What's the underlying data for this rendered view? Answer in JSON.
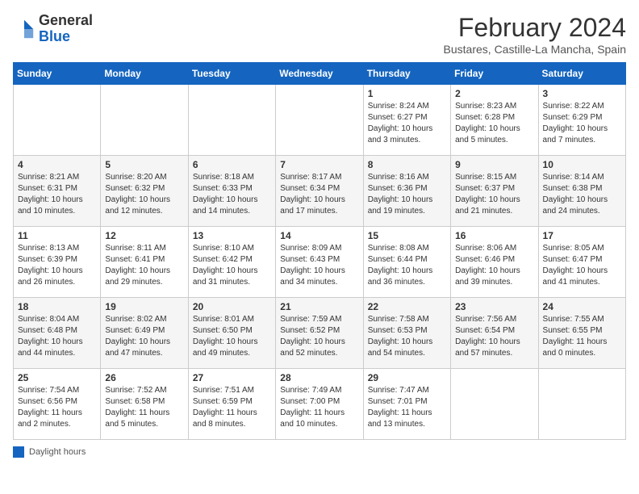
{
  "logo": {
    "general": "General",
    "blue": "Blue"
  },
  "header": {
    "month": "February 2024",
    "location": "Bustares, Castille-La Mancha, Spain"
  },
  "days_of_week": [
    "Sunday",
    "Monday",
    "Tuesday",
    "Wednesday",
    "Thursday",
    "Friday",
    "Saturday"
  ],
  "weeks": [
    [
      {
        "day": "",
        "info": ""
      },
      {
        "day": "",
        "info": ""
      },
      {
        "day": "",
        "info": ""
      },
      {
        "day": "",
        "info": ""
      },
      {
        "day": "1",
        "info": "Sunrise: 8:24 AM\nSunset: 6:27 PM\nDaylight: 10 hours\nand 3 minutes."
      },
      {
        "day": "2",
        "info": "Sunrise: 8:23 AM\nSunset: 6:28 PM\nDaylight: 10 hours\nand 5 minutes."
      },
      {
        "day": "3",
        "info": "Sunrise: 8:22 AM\nSunset: 6:29 PM\nDaylight: 10 hours\nand 7 minutes."
      }
    ],
    [
      {
        "day": "4",
        "info": "Sunrise: 8:21 AM\nSunset: 6:31 PM\nDaylight: 10 hours\nand 10 minutes."
      },
      {
        "day": "5",
        "info": "Sunrise: 8:20 AM\nSunset: 6:32 PM\nDaylight: 10 hours\nand 12 minutes."
      },
      {
        "day": "6",
        "info": "Sunrise: 8:18 AM\nSunset: 6:33 PM\nDaylight: 10 hours\nand 14 minutes."
      },
      {
        "day": "7",
        "info": "Sunrise: 8:17 AM\nSunset: 6:34 PM\nDaylight: 10 hours\nand 17 minutes."
      },
      {
        "day": "8",
        "info": "Sunrise: 8:16 AM\nSunset: 6:36 PM\nDaylight: 10 hours\nand 19 minutes."
      },
      {
        "day": "9",
        "info": "Sunrise: 8:15 AM\nSunset: 6:37 PM\nDaylight: 10 hours\nand 21 minutes."
      },
      {
        "day": "10",
        "info": "Sunrise: 8:14 AM\nSunset: 6:38 PM\nDaylight: 10 hours\nand 24 minutes."
      }
    ],
    [
      {
        "day": "11",
        "info": "Sunrise: 8:13 AM\nSunset: 6:39 PM\nDaylight: 10 hours\nand 26 minutes."
      },
      {
        "day": "12",
        "info": "Sunrise: 8:11 AM\nSunset: 6:41 PM\nDaylight: 10 hours\nand 29 minutes."
      },
      {
        "day": "13",
        "info": "Sunrise: 8:10 AM\nSunset: 6:42 PM\nDaylight: 10 hours\nand 31 minutes."
      },
      {
        "day": "14",
        "info": "Sunrise: 8:09 AM\nSunset: 6:43 PM\nDaylight: 10 hours\nand 34 minutes."
      },
      {
        "day": "15",
        "info": "Sunrise: 8:08 AM\nSunset: 6:44 PM\nDaylight: 10 hours\nand 36 minutes."
      },
      {
        "day": "16",
        "info": "Sunrise: 8:06 AM\nSunset: 6:46 PM\nDaylight: 10 hours\nand 39 minutes."
      },
      {
        "day": "17",
        "info": "Sunrise: 8:05 AM\nSunset: 6:47 PM\nDaylight: 10 hours\nand 41 minutes."
      }
    ],
    [
      {
        "day": "18",
        "info": "Sunrise: 8:04 AM\nSunset: 6:48 PM\nDaylight: 10 hours\nand 44 minutes."
      },
      {
        "day": "19",
        "info": "Sunrise: 8:02 AM\nSunset: 6:49 PM\nDaylight: 10 hours\nand 47 minutes."
      },
      {
        "day": "20",
        "info": "Sunrise: 8:01 AM\nSunset: 6:50 PM\nDaylight: 10 hours\nand 49 minutes."
      },
      {
        "day": "21",
        "info": "Sunrise: 7:59 AM\nSunset: 6:52 PM\nDaylight: 10 hours\nand 52 minutes."
      },
      {
        "day": "22",
        "info": "Sunrise: 7:58 AM\nSunset: 6:53 PM\nDaylight: 10 hours\nand 54 minutes."
      },
      {
        "day": "23",
        "info": "Sunrise: 7:56 AM\nSunset: 6:54 PM\nDaylight: 10 hours\nand 57 minutes."
      },
      {
        "day": "24",
        "info": "Sunrise: 7:55 AM\nSunset: 6:55 PM\nDaylight: 11 hours\nand 0 minutes."
      }
    ],
    [
      {
        "day": "25",
        "info": "Sunrise: 7:54 AM\nSunset: 6:56 PM\nDaylight: 11 hours\nand 2 minutes."
      },
      {
        "day": "26",
        "info": "Sunrise: 7:52 AM\nSunset: 6:58 PM\nDaylight: 11 hours\nand 5 minutes."
      },
      {
        "day": "27",
        "info": "Sunrise: 7:51 AM\nSunset: 6:59 PM\nDaylight: 11 hours\nand 8 minutes."
      },
      {
        "day": "28",
        "info": "Sunrise: 7:49 AM\nSunset: 7:00 PM\nDaylight: 11 hours\nand 10 minutes."
      },
      {
        "day": "29",
        "info": "Sunrise: 7:47 AM\nSunset: 7:01 PM\nDaylight: 11 hours\nand 13 minutes."
      },
      {
        "day": "",
        "info": ""
      },
      {
        "day": "",
        "info": ""
      }
    ]
  ],
  "legend": {
    "box_label": "Daylight hours"
  }
}
